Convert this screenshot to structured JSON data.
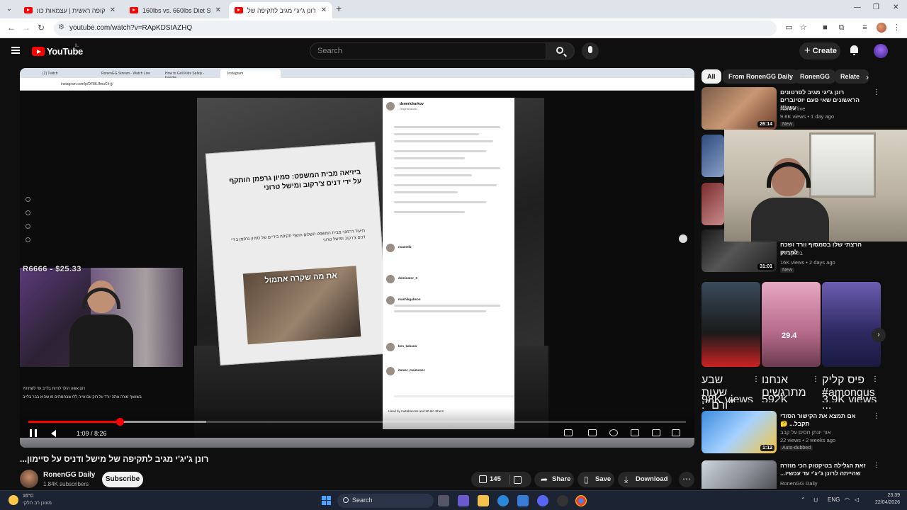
{
  "browser": {
    "tabs": [
      {
        "label": "קופה ראשית | עצמאות כוכבה"
      },
      {
        "label": "160lbs vs. 660lbs Diet Swap - Y"
      },
      {
        "label": "רונן ג'יג'י מגיב לתקיפה של"
      }
    ],
    "url": "youtube.com/watch?v=RApKDSIAZHQ"
  },
  "masthead": {
    "logo_text": "YouTube",
    "country_code": "IL",
    "search_placeholder": "Search",
    "create_label": "Create"
  },
  "player": {
    "inner_tabs": [
      "(2) Twitch",
      "RonenGG Stream - Watch Live",
      "How to Grill Kids Safely - Google",
      "Instagram"
    ],
    "inner_url": "instagram.com/p/DF8KJfmuCh-jj/",
    "bits_overlay": "R6666 - $25.33",
    "time_display": "1:09 / 8:26",
    "progress_fraction": 0.139,
    "buffered_fraction": 0.27,
    "article": {
      "headline": "ביזיאה מבית המשפט: סמיון גרפמן הותקף על ידי דנים צ'רקוב ומישל טרוני",
      "body": "תיעוד דרמטי מבית המשפט השלום חושף תקיפה בידיים של סמיון גרפמן בידי דנים צ'רקוב ומישל טרוני",
      "caption": "את מה שקרה אתמול"
    },
    "insta": {
      "username": "demnicharkov",
      "audio": "Original audio",
      "commenters": [
        "noamelb",
        "dominator_0",
        "mashikgabson",
        "ben_kahana",
        "itamar_maimoner"
      ],
      "likes_text": "Liked by metabacons and 90.6K others"
    },
    "chat": [
      "רונן אשה הולך להיות בלייב עד לשחיה?",
      "בשוואף מורה אתה יורד על רוק עם אייה ללו שבחמתים פו שהיא בבר בלייב"
    ]
  },
  "video": {
    "title": "רונן ג'יג'י מגיב לתקיפה של מישל ודניס על סיימון...",
    "channel_name": "RonenGG Daily",
    "subscribers": "1.84K subscribers",
    "subscribe_label": "Subscribe",
    "likes": "145",
    "share_label": "Share",
    "save_label": "Save",
    "download_label": "Download"
  },
  "chips": [
    "All",
    "From RonenGG Daily",
    "RonenGG",
    "Relate"
  ],
  "recommendations": [
    {
      "title": "רונן ג'יגי מגיב לסרטונים הראשונים שאי פעם יוטיוברים עשו!!!",
      "channel": "Ronen live",
      "views": "9.6K views • 1 day ago",
      "badge": "New",
      "duration": "26:14"
    },
    {
      "title": "הרצתי שלו בסמסוף וורד ושכח למחוק",
      "channel": "בלאקבירד",
      "views": "16K views • 2 days ago",
      "badge": "New",
      "duration": "31:01"
    },
    {
      "title": "אם תמצא את הקישור הסודי תקבל... 🤔",
      "channel": "אור יונתן חסים על קבב",
      "views": "22 views • 2 weeks ago",
      "badge": "Auto-dubbed",
      "duration": "1:12"
    },
    {
      "title": "זאת הגלילה בטיקטוק הכי מוזרה שהייתה לרונן ג'יג'י עד עכשיו...",
      "channel": "RonenGG Daily",
      "views": "",
      "badge": "",
      "duration": ""
    }
  ],
  "shorts": [
    {
      "title": "שבע שעות ״ורם״: נתניהו",
      "views": "98K views",
      "overlay": ""
    },
    {
      "title": "אנחנו מתרגשים",
      "views": "592K views",
      "overlay": "29.4"
    },
    {
      "title": "פיס קליק #amongus ...",
      "views": "3.9K views",
      "overlay": ""
    }
  ],
  "taskbar": {
    "temperature": "16°C",
    "weather": "מעונן רב חלקי",
    "search_label": "Search",
    "language": "ENG",
    "time": "23:39",
    "date": "22/04/2026"
  }
}
